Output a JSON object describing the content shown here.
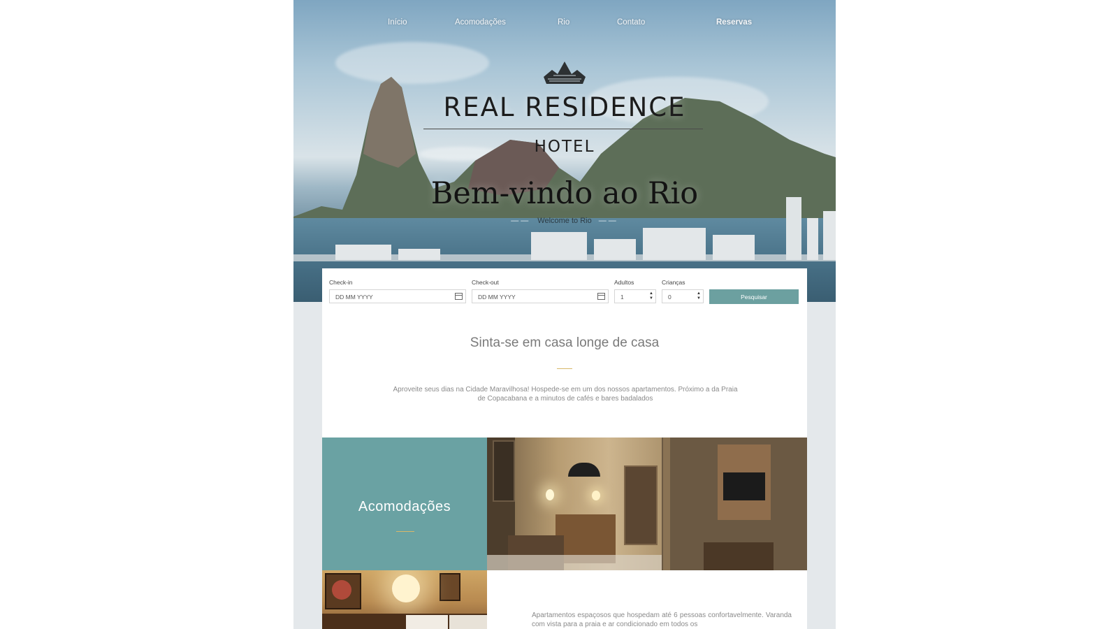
{
  "nav": {
    "items": [
      {
        "label": "Início"
      },
      {
        "label": "Acomodações"
      },
      {
        "label": "Rio"
      },
      {
        "label": "Contato"
      },
      {
        "label": "Reservas"
      }
    ]
  },
  "hero": {
    "logo_main": "REAL RESIDENCE",
    "logo_sub": "HOTEL",
    "welcome_title": "Bem-vindo ao Rio",
    "welcome_subtitle": "Welcome to Rio"
  },
  "booking": {
    "checkin_label": "Check-in",
    "checkin_placeholder": "DD MM YYYY",
    "checkout_label": "Check-out",
    "checkout_placeholder": "DD MM YYYY",
    "adults_label": "Adultos",
    "adults_value": "1",
    "children_label": "Crianças",
    "children_value": "0",
    "search_label": "Pesquisar"
  },
  "intro": {
    "tagline": "Sinta-se em casa longe de casa",
    "text": "Aproveite seus dias na Cidade Maravilhosa! Hospede-se em um dos nossos apartamentos. Próximo a da Praia de Copacabana e a minutos de cafés e bares badalados"
  },
  "rooms": {
    "title": "Acomodações",
    "description": "Apartamentos espaçosos que hospedam até 6 pessoas confortavelmente. Varanda com vista para a praia e ar condicionado em todos os"
  },
  "colors": {
    "accent_teal": "#6aa2a3",
    "gold": "#d8b86a"
  }
}
